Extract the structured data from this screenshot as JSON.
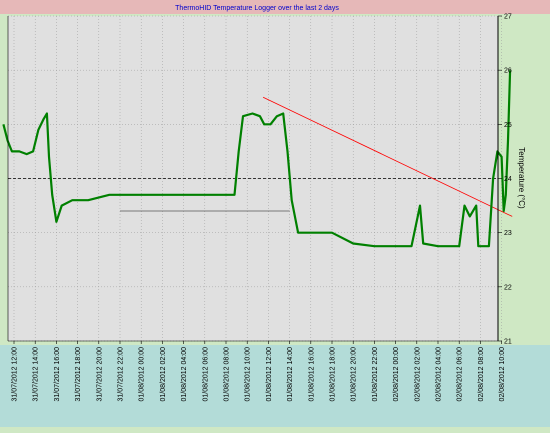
{
  "chart_data": {
    "type": "line",
    "title": "ThermoHID Temperature Logger over the last 2 days",
    "ylabel": "Temperature (°C)",
    "xlabel": "",
    "ylim": [
      21,
      27
    ],
    "y_ticks": [
      21,
      22,
      23,
      24,
      25,
      26,
      27
    ],
    "x_tick_labels": [
      "31/07/2012 12:00",
      "31/07/2012 14:00",
      "31/07/2012 16:00",
      "31/07/2012 18:00",
      "31/07/2012 20:00",
      "31/07/2012 22:00",
      "01/08/2012 00:00",
      "01/08/2012 02:00",
      "01/08/2012 04:00",
      "01/08/2012 06:00",
      "01/08/2012 08:00",
      "01/08/2012 10:00",
      "01/08/2012 12:00",
      "01/08/2012 14:00",
      "01/08/2012 16:00",
      "01/08/2012 18:00",
      "01/08/2012 20:00",
      "01/08/2012 22:00",
      "02/08/2012 00:00",
      "02/08/2012 02:00",
      "02/08/2012 04:00",
      "02/08/2012 06:00",
      "02/08/2012 08:00",
      "02/08/2012 10:00"
    ],
    "grid": true,
    "series": [
      {
        "color": "#008000",
        "points": [
          {
            "x": 11.0,
            "y": 25.0
          },
          {
            "x": 11.4,
            "y": 24.7
          },
          {
            "x": 11.8,
            "y": 24.5
          },
          {
            "x": 12.5,
            "y": 24.5
          },
          {
            "x": 13.2,
            "y": 24.45
          },
          {
            "x": 13.8,
            "y": 24.5
          },
          {
            "x": 14.3,
            "y": 24.9
          },
          {
            "x": 14.8,
            "y": 25.1
          },
          {
            "x": 15.1,
            "y": 25.2
          },
          {
            "x": 15.3,
            "y": 24.4
          },
          {
            "x": 15.6,
            "y": 23.7
          },
          {
            "x": 16.0,
            "y": 23.2
          },
          {
            "x": 16.5,
            "y": 23.5
          },
          {
            "x": 17.5,
            "y": 23.6
          },
          {
            "x": 19.0,
            "y": 23.6
          },
          {
            "x": 21.0,
            "y": 23.7
          },
          {
            "x": 23.0,
            "y": 23.7
          },
          {
            "x": 1.0,
            "y": 23.7
          },
          {
            "x": 3.0,
            "y": 23.7
          },
          {
            "x": 5.0,
            "y": 23.7
          },
          {
            "x": 7.0,
            "y": 23.7
          },
          {
            "x": 8.8,
            "y": 23.7
          },
          {
            "x": 9.2,
            "y": 24.5
          },
          {
            "x": 9.6,
            "y": 25.15
          },
          {
            "x": 10.5,
            "y": 25.2
          },
          {
            "x": 11.2,
            "y": 25.15
          },
          {
            "x": 11.6,
            "y": 25.0
          },
          {
            "x": 12.2,
            "y": 25.0
          },
          {
            "x": 12.8,
            "y": 25.15
          },
          {
            "x": 13.4,
            "y": 25.2
          },
          {
            "x": 13.8,
            "y": 24.5
          },
          {
            "x": 14.2,
            "y": 23.6
          },
          {
            "x": 14.8,
            "y": 23.0
          },
          {
            "x": 16.0,
            "y": 23.0
          },
          {
            "x": 18.0,
            "y": 23.0
          },
          {
            "x": 20.0,
            "y": 22.8
          },
          {
            "x": 22.0,
            "y": 22.75
          },
          {
            "x": 0.0,
            "y": 22.75
          },
          {
            "x": 1.5,
            "y": 22.75
          },
          {
            "x": 2.3,
            "y": 23.5
          },
          {
            "x": 2.6,
            "y": 22.8
          },
          {
            "x": 4.0,
            "y": 22.75
          },
          {
            "x": 6.0,
            "y": 22.75
          },
          {
            "x": 6.5,
            "y": 23.5
          },
          {
            "x": 7.0,
            "y": 23.3
          },
          {
            "x": 7.6,
            "y": 23.5
          },
          {
            "x": 7.8,
            "y": 22.75
          },
          {
            "x": 8.8,
            "y": 22.75
          },
          {
            "x": 9.2,
            "y": 24.0
          },
          {
            "x": 9.6,
            "y": 24.5
          },
          {
            "x": 10.0,
            "y": 24.4
          },
          {
            "x": 10.2,
            "y": 23.4
          },
          {
            "x": 10.4,
            "y": 23.7
          },
          {
            "x": 10.6,
            "y": 24.7
          },
          {
            "x": 10.8,
            "y": 26.0
          }
        ]
      }
    ],
    "reference_lines": [
      {
        "kind": "dashed-horizontal",
        "color": "#000000",
        "y": 24.0
      },
      {
        "kind": "trend",
        "color": "#ff0000",
        "from": {
          "x": "01/08/2012 11:30",
          "y": 25.5
        },
        "to": {
          "x": "02/08/2012 11:00",
          "y": 23.3
        }
      },
      {
        "kind": "solid-segment",
        "color": "#555555",
        "from": {
          "x": "31/07/2012 22:00",
          "y": 23.4
        },
        "to": {
          "x": "01/08/2012 14:00",
          "y": 23.4
        }
      }
    ],
    "colors": {
      "frame_background": "#cfe8c4",
      "title_bar": "#e6b8b8",
      "x_axis_band": "#b3dcd8",
      "plot_background": "#e0e0e0"
    }
  }
}
